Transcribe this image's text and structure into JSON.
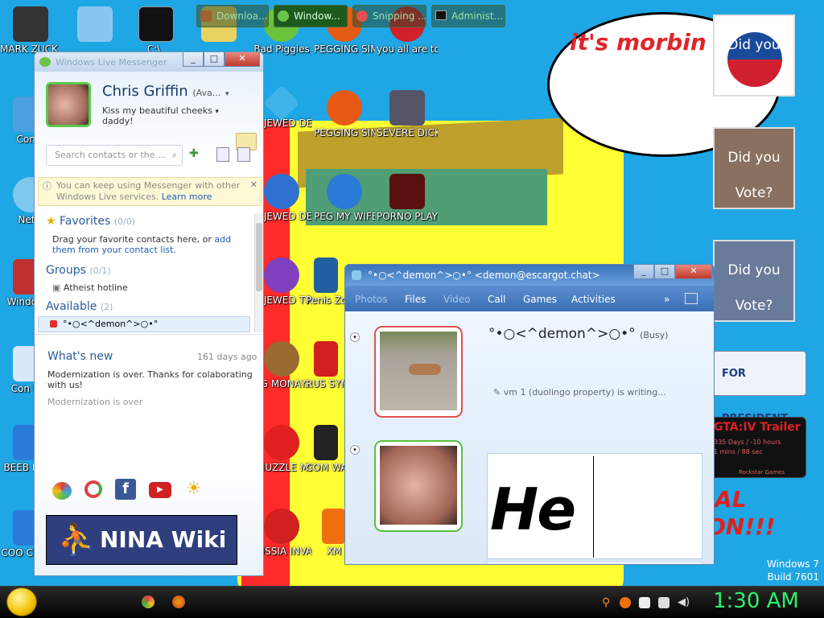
{
  "desktop": {
    "bubble_text": "it's morbin t",
    "icons": [
      {
        "label": "MARK ZUCK..."
      },
      {
        "label": ""
      },
      {
        "label": "C:\\_"
      },
      {
        "label": ""
      },
      {
        "label": "Bad Piggies"
      },
      {
        "label": "PEGGING SIMULAT..."
      },
      {
        "label": "you all are too stupid..."
      },
      {
        "label": "Comp"
      },
      {
        "label": "BEJEWED DELUXE"
      },
      {
        "label": "PEGGING SIMULAT..."
      },
      {
        "label": "SEVERE DICK"
      },
      {
        "label": "Netw"
      },
      {
        "label": "BEJEWED DELUXE"
      },
      {
        "label": "PEG MY WIFE ..."
      },
      {
        "label": "PORNO PLAYER"
      },
      {
        "label": "Windo Vis"
      },
      {
        "label": "BEJEWED TWISTE..."
      },
      {
        "label": "Penis Zombo"
      },
      {
        "label": "Con Pan"
      },
      {
        "label": "BIG MONAY..."
      },
      {
        "label": "RUS SYM"
      },
      {
        "label": "BEEB BEEB"
      },
      {
        "label": "CHUZZLE MY CUM"
      },
      {
        "label": "COM WAG"
      },
      {
        "label": "COO CLEA..."
      },
      {
        "label": "RUSSIA INVADES ..."
      },
      {
        "label": "XM"
      }
    ],
    "posters": [
      {
        "t1": "Did you",
        "t2": ""
      },
      {
        "t1": "Did you",
        "t2": "Vote?"
      },
      {
        "t1": "Did you",
        "t2": "Vote?"
      }
    ],
    "president_banner": "FOR PRESIDENT",
    "gta_title": "GTA:IV Trailer",
    "gta_line1": "335 Days / -10 hours",
    "gta_line2": "1 mins / 88 sec",
    "gta_footer": "Rockstar Games",
    "red_text1": "AL",
    "red_text2": "ON!!!",
    "windows_version": "Windows 7",
    "build": "Build 7601"
  },
  "messenger": {
    "window_title": "Windows Live Messenger",
    "user_name": "Chris Griffin",
    "status": "(Ava...",
    "message_line1": "Kiss my beautiful cheeks",
    "message_line2": "daddy!",
    "search_placeholder": "Search contacts or the ...",
    "info_text": "You can keep using Messenger with other Windows Live services.",
    "learn_more": "Learn more",
    "favorites_label": "Favorites",
    "favorites_count": "(0/0)",
    "favorites_hint1": "Drag your favorite contacts here, or",
    "favorites_link1": "add them",
    "favorites_link2": "from your contact list.",
    "groups_label": "Groups",
    "groups_count": "(0/1)",
    "group_item": "Atheist hotline",
    "available_label": "Available",
    "available_count": "(2)",
    "contact_name": "°•○<^demon^>○•°",
    "whats_new_label": "What's new",
    "whats_new_time": "161 days ago",
    "news_line1": "Modernization is over. Thanks for colaborating",
    "news_line2": "with us!",
    "news_line3": "Modernization is over",
    "ad_text": "NINA Wiki"
  },
  "chat": {
    "title": "°•○<^demon^>○•° <demon@escargot.chat>",
    "menu": [
      "Photos",
      "Files",
      "Video",
      "Call",
      "Games",
      "Activities",
      "»"
    ],
    "contact_name": "°•○<^demon^>○•°",
    "contact_status": "(Busy)",
    "typing_text": "vm 1 (duolingo property) is writing...",
    "compose_text": "He"
  },
  "taskbar": {
    "items": [
      "Downloa...",
      "Window...",
      "Snipping ...",
      "Administ..."
    ],
    "clock": "1:30 AM"
  },
  "colors": {
    "desktop": "#1fa6e4",
    "clock": "#29f36b",
    "accent": "#2a5c9a"
  }
}
